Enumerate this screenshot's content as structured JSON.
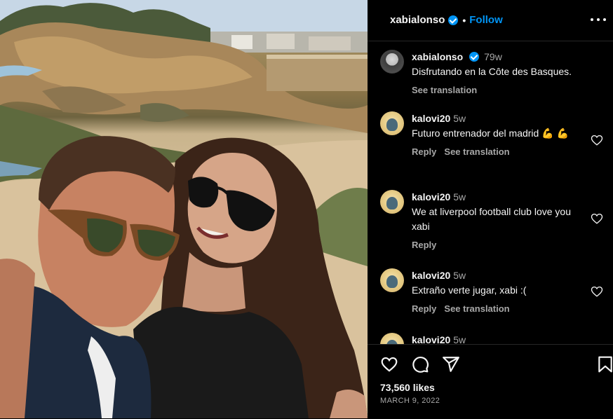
{
  "post": {
    "image_alt": "Selfie of a man with sunglasses and a woman on a beach with rocks",
    "header": {
      "username": "xabialonso",
      "separator": "•",
      "follow_label": "Follow",
      "more_icon": "more-options-icon"
    }
  },
  "comments": [
    {
      "username": "xabialonso",
      "verified": true,
      "time": "79w",
      "text": "Disfrutando en la Côte des Basques.",
      "actions": [
        "See translation"
      ]
    },
    {
      "username": "kalovi20",
      "time": "5w",
      "text": "Futuro entrenador del madrid 💪 💪",
      "actions": [
        "Reply",
        "See translation"
      ]
    },
    {
      "username": "kalovi20",
      "time": "5w",
      "text": "We at liverpool football club love you xabi",
      "actions": [
        "Reply"
      ]
    },
    {
      "username": "kalovi20",
      "time": "5w",
      "text": "Extraño verte jugar, xabi :(",
      "actions": [
        "Reply",
        "See translation"
      ]
    },
    {
      "username": "kalovi20",
      "time": "5w",
      "text": "",
      "actions": []
    }
  ],
  "footer": {
    "likes": "73,560 likes",
    "date": "MARCH 9, 2022"
  },
  "colors": {
    "accent": "#0095f6",
    "muted": "#a8a8a8",
    "background": "#000000"
  }
}
